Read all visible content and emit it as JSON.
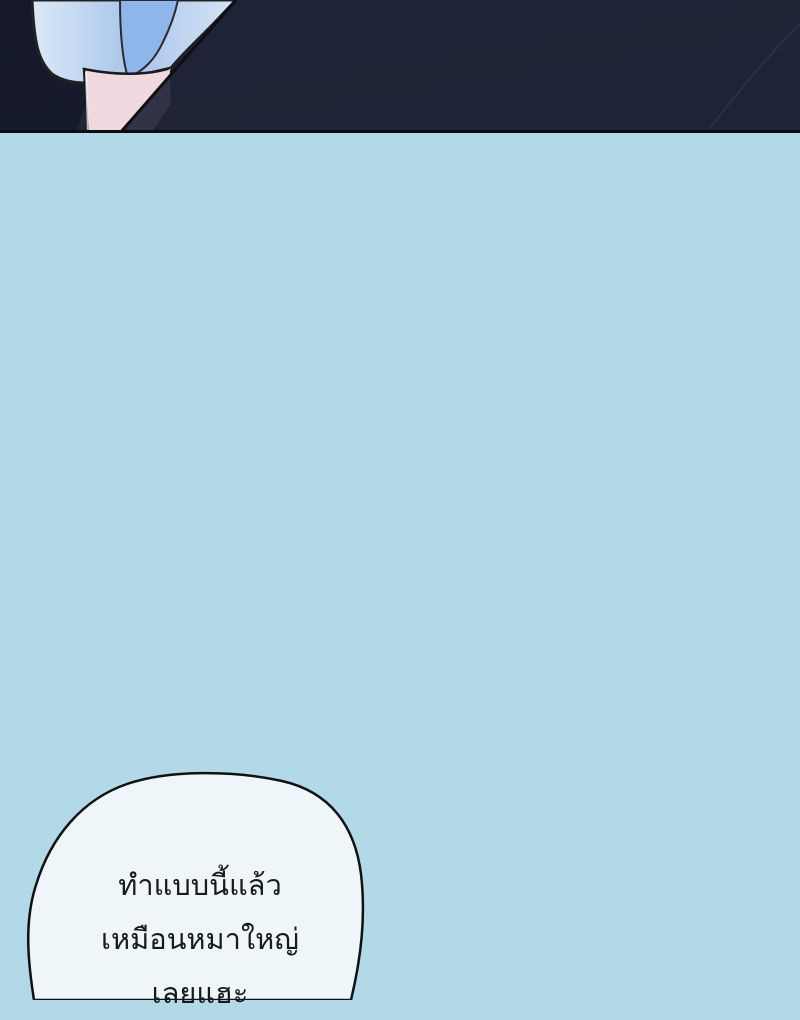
{
  "speech_bubble": {
    "text": "ทำแบบนี้แล้ว\nเหมือนหมาใหญ่\nเลยแฮะ"
  },
  "colors": {
    "night_background": "#1d2133",
    "sky_background": "#b2d9e7",
    "bubble_fill": "#eef6f9",
    "outline": "#111111"
  }
}
